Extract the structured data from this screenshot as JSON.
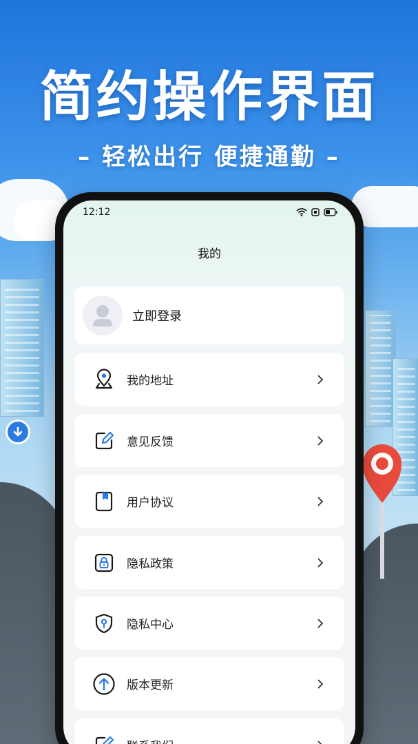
{
  "promo": {
    "headline": "简约操作界面",
    "subline": "–  轻松出行  便捷通勤  –"
  },
  "status_bar": {
    "time": "12:12",
    "icons": [
      "wifi-icon",
      "sim-icon",
      "battery-icon"
    ]
  },
  "page": {
    "title": "我的"
  },
  "login": {
    "label": "立即登录",
    "icon": "avatar-icon"
  },
  "menu": [
    {
      "label": "我的地址",
      "icon": "location-pin-icon"
    },
    {
      "label": "意见反馈",
      "icon": "edit-icon"
    },
    {
      "label": "用户协议",
      "icon": "book-icon"
    },
    {
      "label": "隐私政策",
      "icon": "lock-icon"
    },
    {
      "label": "隐私中心",
      "icon": "shield-icon"
    },
    {
      "label": "版本更新",
      "icon": "upload-arrow-icon"
    },
    {
      "label": "联系我们",
      "icon": "contact-icon"
    }
  ],
  "colors": {
    "accent": "#2b7be4",
    "icon_stroke": "#1a1a1a",
    "card_bg": "#ffffff",
    "page_bg": "#f4f5f7"
  }
}
